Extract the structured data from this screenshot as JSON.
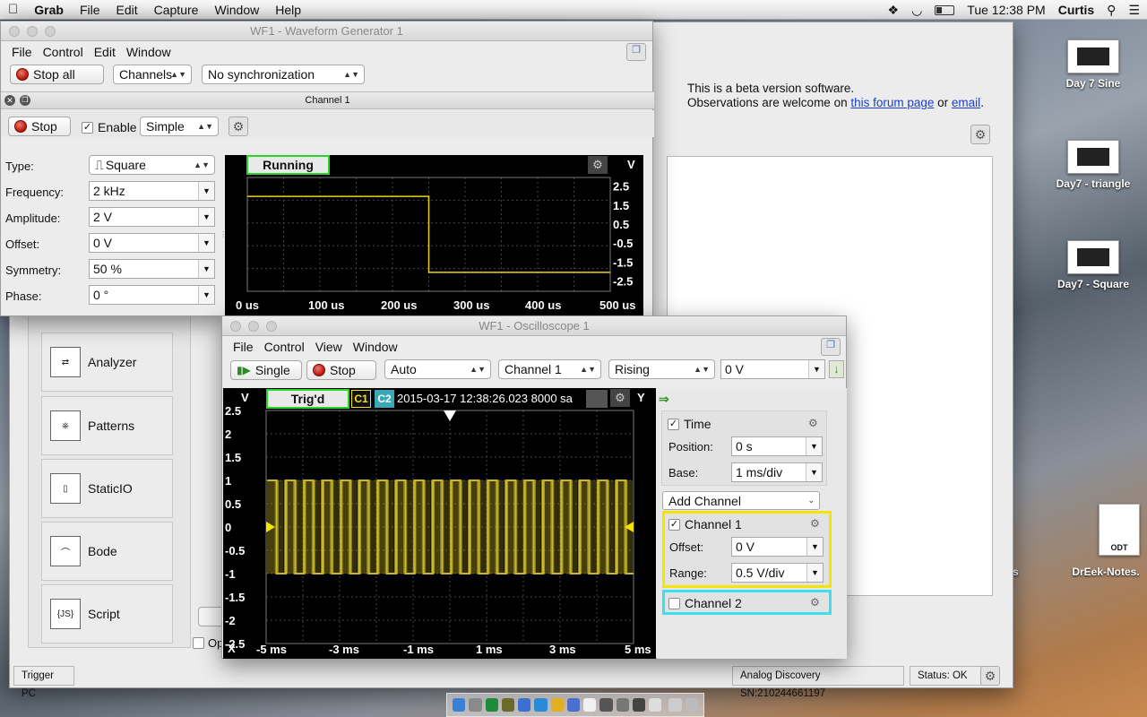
{
  "menubar": {
    "app": "Grab",
    "items": [
      "File",
      "Edit",
      "Capture",
      "Window",
      "Help"
    ],
    "clock": "Tue 12:38 PM",
    "user": "Curtis"
  },
  "desktop": {
    "icons": [
      "Day 7 Sine",
      "Day7 - triangle",
      "Day7 - Square"
    ],
    "odt_label": "ODT",
    "odt_name": "DrEek-Notes.",
    "partial_name": "otes",
    "partial_name2": "oc"
  },
  "main_window": {
    "beta_line1": "This is a beta version software.",
    "beta_line2": "Observations are welcome on ",
    "forum_link": "this forum page",
    "or_text": " or ",
    "email_link": "email",
    "period": ".",
    "tools": [
      "Analyzer",
      "Patterns",
      "StaticIO",
      "Bode",
      "Script"
    ],
    "tool_icons": [
      "analyzer-icon",
      "patterns-icon",
      "staticio-icon",
      "bode-icon",
      "script-icon"
    ],
    "script_icon_text": "{JS}",
    "partial_checkbox_label": "Op",
    "trigger_pc": "Trigger PC",
    "device": "Analog Discovery SN:210244661197",
    "status": "Status: OK"
  },
  "wavegen": {
    "title": "WF1 - Waveform Generator 1",
    "menu": [
      "File",
      "Control",
      "Edit",
      "Window"
    ],
    "stop_all": "Stop all",
    "channels": "Channels",
    "sync": "No synchronization",
    "channel_title": "Channel 1",
    "stop": "Stop",
    "enable_label": "Enable",
    "enable_checked": true,
    "mode": "Simple",
    "fields": [
      {
        "label": "Type:",
        "value": "Square",
        "kind": "select"
      },
      {
        "label": "Frequency:",
        "value": "2 kHz",
        "kind": "combo"
      },
      {
        "label": "Amplitude:",
        "value": "2 V",
        "kind": "combo"
      },
      {
        "label": "Offset:",
        "value": "0 V",
        "kind": "combo"
      },
      {
        "label": "Symmetry:",
        "value": "50 %",
        "kind": "combo"
      },
      {
        "label": "Phase:",
        "value": "0 °",
        "kind": "combo"
      }
    ],
    "state": "Running",
    "y_unit": "V",
    "y_ticks": [
      "2.5",
      "1.5",
      "0.5",
      "-0.5",
      "-1.5",
      "-2.5"
    ],
    "x_ticks": [
      "0 us",
      "100 us",
      "200 us",
      "300 us",
      "400 us",
      "500 us"
    ],
    "trace_color": "#e8d21a"
  },
  "scope": {
    "title": "WF1 - Oscilloscope 1",
    "menu": [
      "File",
      "Control",
      "View",
      "Window"
    ],
    "single": "Single",
    "stop": "Stop",
    "mode": "Auto",
    "source": "Channel 1",
    "edge": "Rising",
    "level": "0 V",
    "state": "Trig'd",
    "c1": "C1",
    "c2": "C2",
    "timestamp": "2015-03-17 12:38:26.023 8000 sa",
    "y_label": "V",
    "y_header": "Y",
    "x_label": "X",
    "y_ticks": [
      "2.5",
      "2",
      "1.5",
      "1",
      "0.5",
      "0",
      "-0.5",
      "-1",
      "-1.5",
      "-2",
      "-2.5"
    ],
    "x_ticks": [
      "-5 ms",
      "-3 ms",
      "-1 ms",
      "1 ms",
      "3 ms",
      "5 ms"
    ],
    "time": {
      "label": "Time",
      "checked": true,
      "position_label": "Position:",
      "position": "0 s",
      "base_label": "Base:",
      "base": "1 ms/div"
    },
    "add_channel": "Add Channel",
    "ch1": {
      "label": "Channel 1",
      "checked": true,
      "offset_label": "Offset:",
      "offset": "0 V",
      "range_label": "Range:",
      "range": "0.5 V/div",
      "color": "#f2e600"
    },
    "ch2": {
      "label": "Channel 2",
      "checked": false,
      "color": "#38e0f0"
    },
    "trace_color": "#c9b62a"
  }
}
